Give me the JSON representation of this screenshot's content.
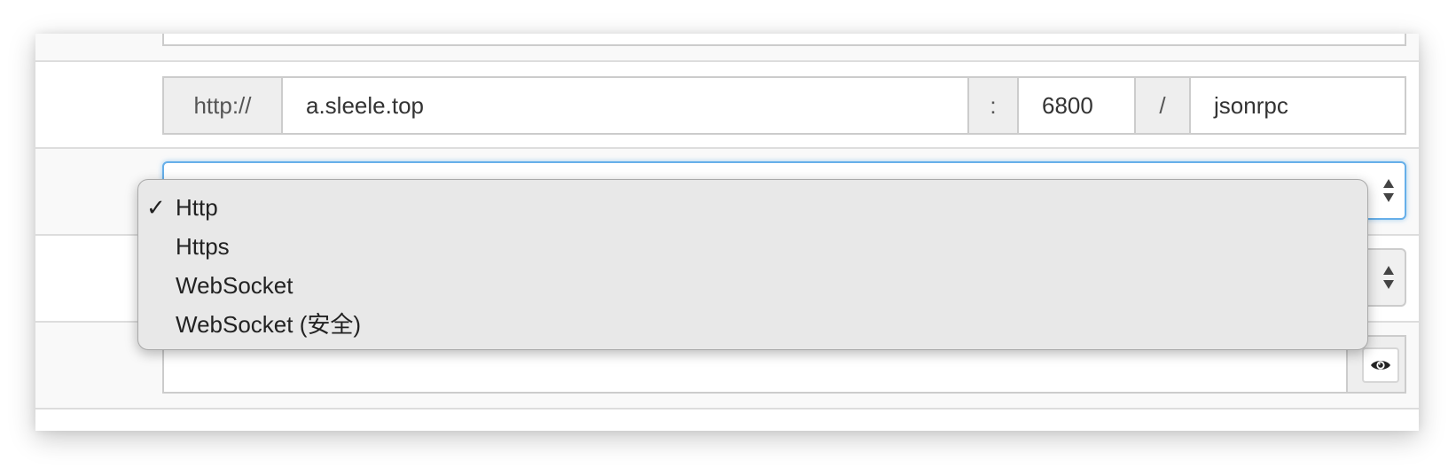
{
  "rpc_address": {
    "protocol_prefix": "http://",
    "host": "a.sleele.top",
    "port_separator": ":",
    "port": "6800",
    "path_separator": "/",
    "path": "jsonrpc"
  },
  "protocol_select": {
    "options": [
      {
        "label": "Http",
        "selected": true,
        "check": "✓"
      },
      {
        "label": "Https",
        "selected": false,
        "check": ""
      },
      {
        "label": "WebSocket",
        "selected": false,
        "check": ""
      },
      {
        "label": "WebSocket (安全)",
        "selected": false,
        "check": ""
      }
    ]
  },
  "secret_field": {
    "value": "",
    "toggle_icon": "eye-icon"
  },
  "colors": {
    "focus_border": "#66afe9",
    "input_border": "#cccccc",
    "addon_background": "#eeeeee",
    "dropdown_background": "#e8e8e8"
  }
}
